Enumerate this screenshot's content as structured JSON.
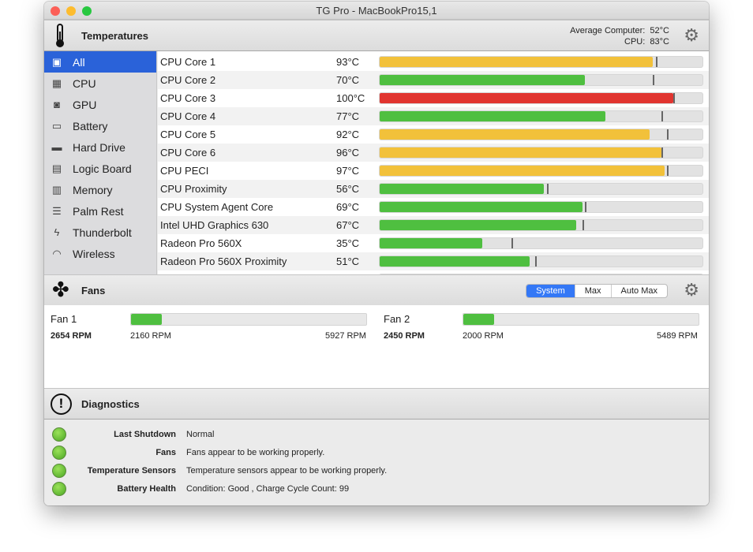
{
  "window": {
    "title": "TG Pro - MacBookPro15,1"
  },
  "temperatures": {
    "title": "Temperatures",
    "avg_label": "Average Computer:",
    "avg_value": "52°C",
    "cpu_label": "CPU:",
    "cpu_value": "83°C",
    "scale_max_c": 110
  },
  "sidebar": {
    "items": [
      {
        "label": "All",
        "icon": "computer-icon",
        "glyph": "▣",
        "selected": true
      },
      {
        "label": "CPU",
        "icon": "cpu-icon",
        "glyph": "▦"
      },
      {
        "label": "GPU",
        "icon": "gpu-icon",
        "glyph": "◙"
      },
      {
        "label": "Battery",
        "icon": "battery-icon",
        "glyph": "▭"
      },
      {
        "label": "Hard Drive",
        "icon": "hard-drive-icon",
        "glyph": "▬"
      },
      {
        "label": "Logic Board",
        "icon": "logic-board-icon",
        "glyph": "▤"
      },
      {
        "label": "Memory",
        "icon": "memory-icon",
        "glyph": "▥"
      },
      {
        "label": "Palm Rest",
        "icon": "palm-rest-icon",
        "glyph": "☰"
      },
      {
        "label": "Thunderbolt",
        "icon": "thunderbolt-icon",
        "glyph": "ϟ"
      },
      {
        "label": "Wireless",
        "icon": "wireless-icon",
        "glyph": "◠"
      }
    ]
  },
  "sensors": [
    {
      "name": "CPU Core 1",
      "temp": "93°C",
      "value": 93,
      "max": 94,
      "color": "#f2c13a"
    },
    {
      "name": "CPU Core 2",
      "temp": "70°C",
      "value": 70,
      "max": 93,
      "color": "#4fbf40"
    },
    {
      "name": "CPU Core 3",
      "temp": "100°C",
      "value": 100,
      "max": 100,
      "color": "#e13530"
    },
    {
      "name": "CPU Core 4",
      "temp": "77°C",
      "value": 77,
      "max": 96,
      "color": "#4fbf40"
    },
    {
      "name": "CPU Core 5",
      "temp": "92°C",
      "value": 92,
      "max": 98,
      "color": "#f2c13a"
    },
    {
      "name": "CPU Core 6",
      "temp": "96°C",
      "value": 96,
      "max": 96,
      "color": "#f2c13a"
    },
    {
      "name": "CPU PECI",
      "temp": "97°C",
      "value": 97,
      "max": 98,
      "color": "#f2c13a"
    },
    {
      "name": "CPU Proximity",
      "temp": "56°C",
      "value": 56,
      "max": 57,
      "color": "#4fbf40"
    },
    {
      "name": "CPU System Agent Core",
      "temp": "69°C",
      "value": 69,
      "max": 70,
      "color": "#4fbf40"
    },
    {
      "name": "Intel UHD Graphics 630",
      "temp": "67°C",
      "value": 67,
      "max": 69,
      "color": "#4fbf40"
    },
    {
      "name": "Radeon Pro 560X",
      "temp": "35°C",
      "value": 35,
      "max": 45,
      "color": "#4fbf40"
    },
    {
      "name": "Radeon Pro 560X Proximity",
      "temp": "51°C",
      "value": 51,
      "max": 53,
      "color": "#4fbf40"
    },
    {
      "name": "",
      "temp": "",
      "value": 37,
      "max": 43,
      "color": "#4fbf40"
    }
  ],
  "fans": {
    "title": "Fans",
    "modes": [
      "System",
      "Max",
      "Auto Max"
    ],
    "selected_mode": "System",
    "items": [
      {
        "name": "Fan 1",
        "rpm": "2654 RPM",
        "min": "2160 RPM",
        "max": "5927 RPM",
        "fraction": 0.13
      },
      {
        "name": "Fan 2",
        "rpm": "2450 RPM",
        "min": "2000 RPM",
        "max": "5489 RPM",
        "fraction": 0.13
      }
    ]
  },
  "diagnostics": {
    "title": "Diagnostics",
    "items": [
      {
        "label": "Last Shutdown",
        "value": "Normal"
      },
      {
        "label": "Fans",
        "value": "Fans appear to be working properly."
      },
      {
        "label": "Temperature Sensors",
        "value": "Temperature sensors appear to be working properly."
      },
      {
        "label": "Battery Health",
        "value": "Condition: Good , Charge Cycle Count: 99"
      }
    ]
  }
}
